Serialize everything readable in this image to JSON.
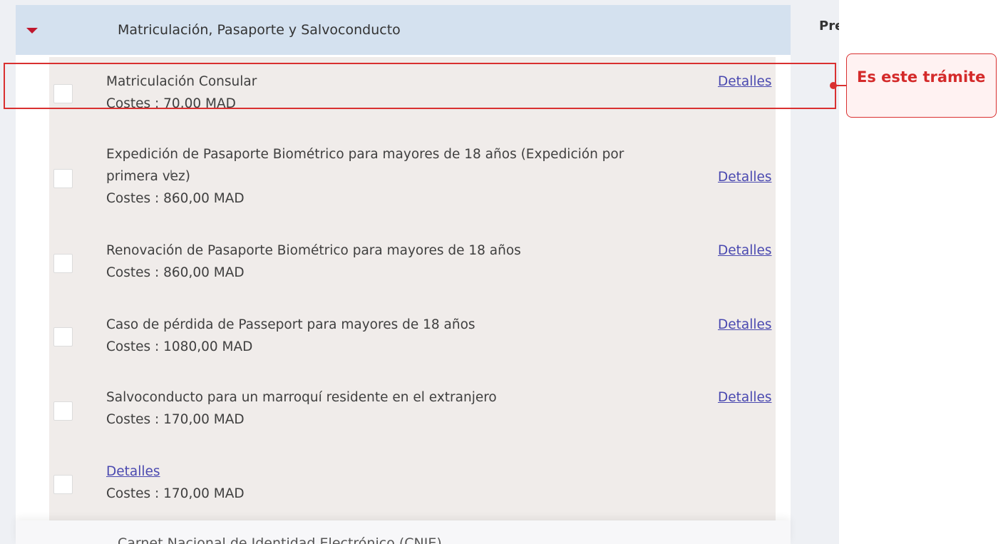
{
  "accordion": {
    "title": "Matriculación, Pasaporte y Salvoconducto",
    "next_title": "Carnet Nacional de Identidad Electrónico (CNIE)"
  },
  "side": {
    "pre_text": "Pre"
  },
  "items": [
    {
      "name": "Matriculación Consular",
      "cost": "Costes : 70,00 MAD",
      "link": "Detalles"
    },
    {
      "name_line1": "Expedición de Pasaporte Biométrico para mayores de 18 años (Expedición por",
      "name_line2": "primera vez)",
      "cost": "Costes : 860,00 MAD",
      "link": "Detalles"
    },
    {
      "name": "Renovación de Pasaporte Biométrico para mayores de 18 años",
      "cost": "Costes : 860,00 MAD",
      "link": "Detalles"
    },
    {
      "name": "Caso de pérdida de Passeport para mayores de 18 años",
      "cost": "Costes : 1080,00 MAD",
      "link": "Detalles"
    },
    {
      "name": "Salvoconducto para un marroquí residente en el extranjero",
      "cost": "Costes : 170,00 MAD",
      "link": "Detalles"
    },
    {
      "link_inline": "Detalles",
      "cost": "Costes : 170,00 MAD"
    }
  ],
  "annotation": {
    "label": "Es este trámite",
    "color": "#d93030"
  },
  "colors": {
    "caret": "#c0172d",
    "link": "#4a49b0",
    "header_bg": "#d4e1ef",
    "panel_bg": "#f0ecea"
  }
}
